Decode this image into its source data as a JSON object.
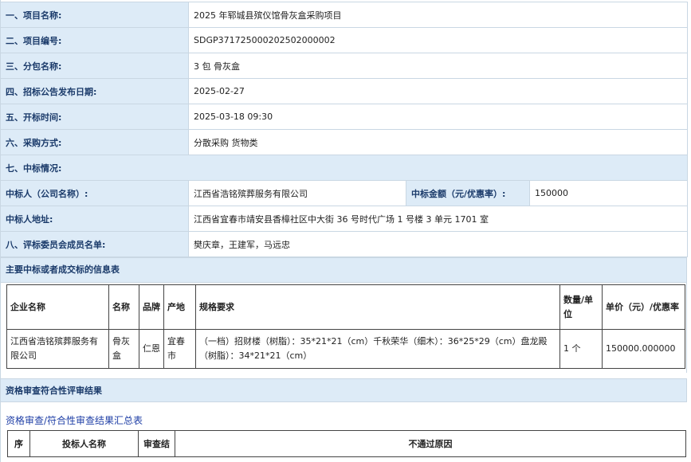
{
  "info_rows": [
    {
      "label": "一、项目名称:",
      "value": "2025 年郓城县殡仪馆骨灰盒采购项目"
    },
    {
      "label": "二、项目编号:",
      "value": "SDGP371725000202502000002"
    },
    {
      "label": "三、分包名称:",
      "value": "3 包  骨灰盒"
    },
    {
      "label": "四、招标公告发布日期:",
      "value": "2025-02-27"
    },
    {
      "label": "五、开标时间:",
      "value": "2025-03-18 09:30"
    },
    {
      "label": "六、采购方式:",
      "value": "分散采购  货物类"
    }
  ],
  "section7": "七、中标情况:",
  "winner": {
    "name_label": "中标人（公司名称）:",
    "name_value": "江西省浩铭殡葬服务有限公司",
    "amount_label": "中标金额（元/优惠率）:",
    "amount_value": "150000",
    "address_label": "中标人地址:",
    "address_value": "江西省宜春市靖安县香樟社区中大街 36 号时代广场 1 号楼 3 单元 1701 室"
  },
  "committee": {
    "label": "八、评标委员会成员名单:",
    "value": "樊庆章，王建军，马远忠"
  },
  "main_items_title": "主要中标或者成交标的信息表",
  "items_table": {
    "headers": [
      "企业名称",
      "名称",
      "品牌",
      "产地",
      "规格要求",
      "数量/单位",
      "单价（元）/优惠率"
    ],
    "rows": [
      [
        "江西省浩铭殡葬服务有限公司",
        "骨灰盒",
        "仁恩",
        "宜春市",
        "（一档）招财楼（树脂）：35*21*21（cm）千秋荣华（细木）：36*25*29（cm）盘龙殿（树脂）：34*21*21（cm）",
        "1 个",
        "150000.000000"
      ]
    ]
  },
  "qual_title": "资格审查符合性评审结果",
  "qual_link": "资格审查/符合性审查结果汇总表",
  "qual_table_headers": [
    "序",
    "投标人名称",
    "审查结",
    "不通过原因"
  ]
}
